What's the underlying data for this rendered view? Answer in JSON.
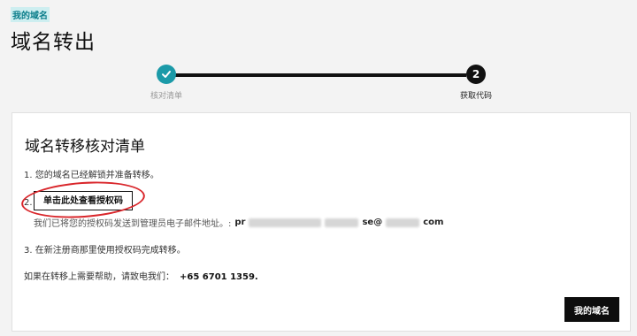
{
  "breadcrumb": {
    "link": "我的域名"
  },
  "page": {
    "title": "域名转出"
  },
  "stepper": {
    "steps": [
      {
        "label": "核对清单",
        "state": "done"
      },
      {
        "label": "获取代码",
        "number": "2",
        "state": "active"
      }
    ]
  },
  "checklist": {
    "title": "域名转移核对清单",
    "item1": "1. 您的域名已经解锁并准备转移。",
    "item2_number": "2.",
    "auth_button": "单击此处查看授权码",
    "sent_text": "我们已将您的授权码发送到管理员电子邮件地址。:",
    "email_start": "pr",
    "email_mid": "se@",
    "email_end": "com",
    "item3": "3. 在新注册商那里使用授权码完成转移。",
    "help_text": "如果在转移上需要帮助，请致电我们：",
    "phone": "+65 6701 1359."
  },
  "footer": {
    "my_domains_button": "我的域名"
  },
  "colors": {
    "accent": "#1b9aa8",
    "annotation": "#d9262b",
    "dark": "#111111"
  }
}
